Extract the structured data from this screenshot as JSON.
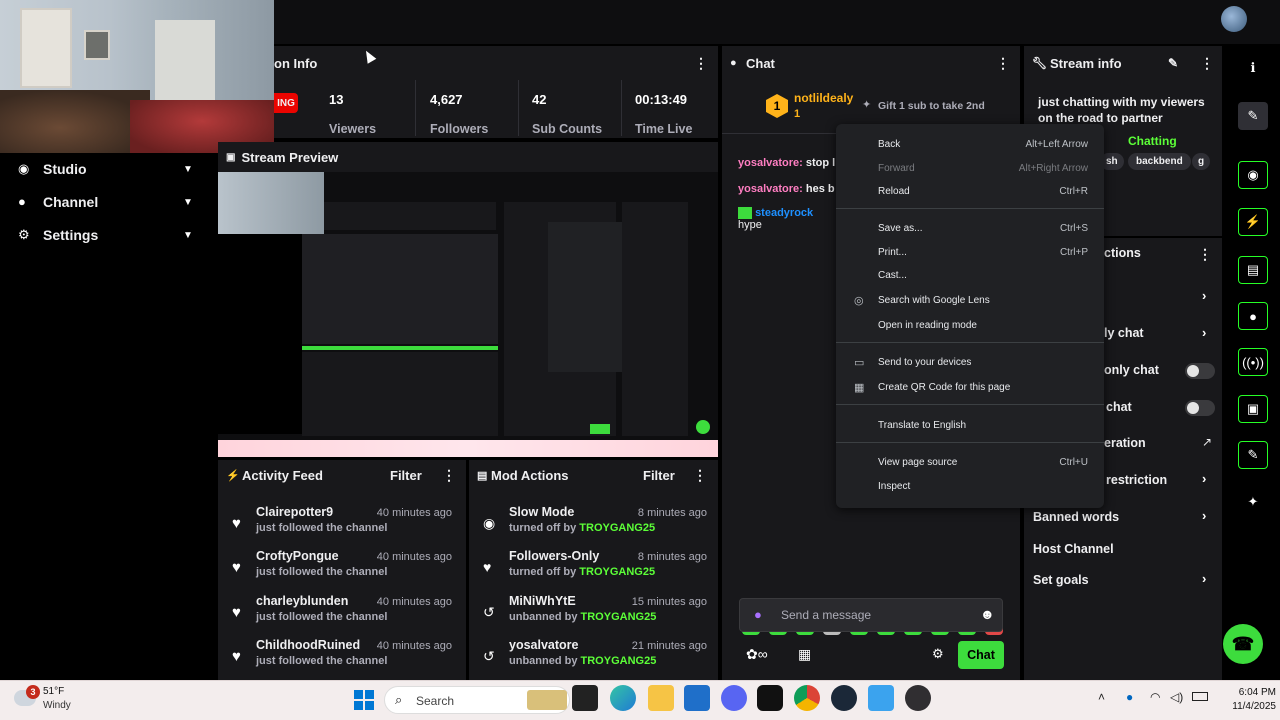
{
  "stream_info_panel": {
    "title": "on Info",
    "live_badge": "ING",
    "stats": [
      {
        "value": "13",
        "label": "Viewers"
      },
      {
        "value": "4,627",
        "label": "Followers"
      },
      {
        "value": "42",
        "label": "Sub Counts"
      },
      {
        "value": "00:13:49",
        "label": "Time Live"
      }
    ]
  },
  "sidebar": {
    "items": [
      {
        "label": "Studio",
        "icon": "camera-icon"
      },
      {
        "label": "Channel",
        "icon": "user-icon"
      },
      {
        "label": "Settings",
        "icon": "gear-icon"
      }
    ]
  },
  "stream_preview": {
    "title": "Stream Preview"
  },
  "activity_feed": {
    "title": "Activity Feed",
    "filter": "Filter",
    "items": [
      {
        "name": "Clairepotter9",
        "sub": "just followed the channel",
        "time": "40 minutes ago"
      },
      {
        "name": "CroftyPongue",
        "sub": "just followed the channel",
        "time": "40 minutes ago"
      },
      {
        "name": "charleyblunden",
        "sub": "just followed the channel",
        "time": "40 minutes ago"
      },
      {
        "name": "ChildhoodRuined",
        "sub": "just followed the channel",
        "time": "40 minutes ago"
      }
    ]
  },
  "mod_actions": {
    "title": "Mod Actions",
    "filter": "Filter",
    "items": [
      {
        "name": "Slow Mode",
        "action": "turned off by",
        "by": "TROYGANG25",
        "time": "8 minutes ago"
      },
      {
        "name": "Followers-Only",
        "action": "turned off by",
        "by": "TROYGANG25",
        "time": "8 minutes ago"
      },
      {
        "name": "MiNiWhYtE",
        "action": "unbanned by",
        "by": "TROYGANG25",
        "time": "15 minutes ago"
      },
      {
        "name": "yosalvatore",
        "action": "unbanned by",
        "by": "TROYGANG25",
        "time": "21 minutes ago"
      }
    ]
  },
  "chat": {
    "title": "Chat",
    "gift_user": "notlildealy",
    "gift_rank": "1",
    "gift_text": "Gift 1 sub to take 2nd",
    "messages": [
      {
        "user": "yosalvatore:",
        "text": "stop l"
      },
      {
        "user": "yosalvatore:",
        "text": "hes b"
      },
      {
        "user": "steadyrock",
        "text": "hype"
      }
    ],
    "input_placeholder": "Send a message",
    "send_label": "Chat"
  },
  "stream_info": {
    "title": "Stream info",
    "description": "just chatting with my viewers on the road to partner",
    "category": "Chatting",
    "tags": [
      "sh",
      "backbend",
      "g"
    ]
  },
  "quick_actions": {
    "title": "ctions",
    "items": [
      {
        "label": "ly chat"
      },
      {
        "label": "only chat"
      },
      {
        "label": "chat"
      },
      {
        "label": "eration"
      },
      {
        "label": "restriction"
      },
      {
        "label": "Banned words"
      },
      {
        "label": "Host Channel"
      },
      {
        "label": "Set goals"
      }
    ]
  },
  "context_menu": {
    "items": [
      {
        "label": "Back",
        "shortcut": "Alt+Left Arrow"
      },
      {
        "label": "Forward",
        "shortcut": "Alt+Right Arrow"
      },
      {
        "label": "Reload",
        "shortcut": "Ctrl+R"
      },
      {
        "label": "Save as...",
        "shortcut": "Ctrl+S"
      },
      {
        "label": "Print...",
        "shortcut": "Ctrl+P"
      },
      {
        "label": "Cast...",
        "shortcut": ""
      },
      {
        "label": "Search with Google Lens",
        "shortcut": ""
      },
      {
        "label": "Open in reading mode",
        "shortcut": ""
      },
      {
        "label": "Send to your devices",
        "shortcut": ""
      },
      {
        "label": "Create QR Code for this page",
        "shortcut": ""
      },
      {
        "label": "Translate to English",
        "shortcut": ""
      },
      {
        "label": "View page source",
        "shortcut": "Ctrl+U"
      },
      {
        "label": "Inspect",
        "shortcut": ""
      }
    ]
  },
  "taskbar": {
    "weather_temp": "51°F",
    "weather_desc": "Windy",
    "weather_badge": "3",
    "search_label": "Search",
    "time": "6:04 PM",
    "date": "11/4/2025"
  },
  "colors": {
    "accent": "#5cff38",
    "panel": "#1f1f23",
    "live": "#eb0400",
    "gold": "#ffb31a"
  }
}
